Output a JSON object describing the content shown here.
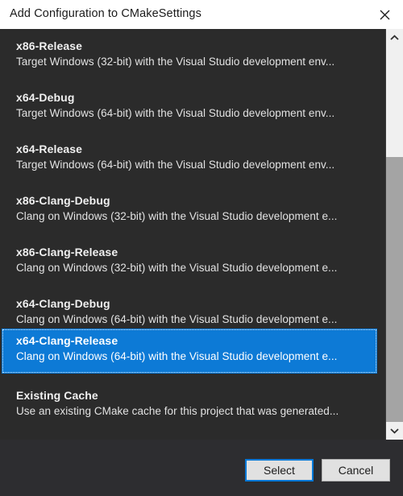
{
  "window": {
    "title": "Add Configuration to CMakeSettings",
    "close_icon": "close-icon"
  },
  "colors": {
    "accent": "#0d7ad6",
    "titlebar_bg": "#ffffff",
    "list_bg": "#2b2b2b",
    "dialog_bg": "#2d2d30",
    "button_bg": "#e1e1e1",
    "focus_border": "#0078d7",
    "scrollbar_thumb": "#a4a4a4",
    "scrollbar_track": "#f0f0f0"
  },
  "list": {
    "name": "configuration-list",
    "selected_index": 6,
    "items": [
      {
        "title": "x86-Release",
        "description": "Target Windows (32-bit) with the Visual Studio development env..."
      },
      {
        "title": "x64-Debug",
        "description": "Target Windows (64-bit) with the Visual Studio development env..."
      },
      {
        "title": "x64-Release",
        "description": "Target Windows (64-bit) with the Visual Studio development env..."
      },
      {
        "title": "x86-Clang-Debug",
        "description": "Clang on Windows (32-bit) with the Visual Studio development e..."
      },
      {
        "title": "x86-Clang-Release",
        "description": "Clang on Windows (32-bit) with the Visual Studio development e..."
      },
      {
        "title": "x64-Clang-Debug",
        "description": "Clang on Windows (64-bit) with the Visual Studio development e..."
      },
      {
        "title": "x64-Clang-Release",
        "description": "Clang on Windows (64-bit) with the Visual Studio development e..."
      },
      {
        "title": "Existing Cache",
        "description": "Use an existing CMake cache for this project that was generated..."
      }
    ]
  },
  "scrollbar": {
    "up_icon": "chevron-up-icon",
    "down_icon": "chevron-down-icon"
  },
  "footer": {
    "select_label": "Select",
    "cancel_label": "Cancel"
  }
}
